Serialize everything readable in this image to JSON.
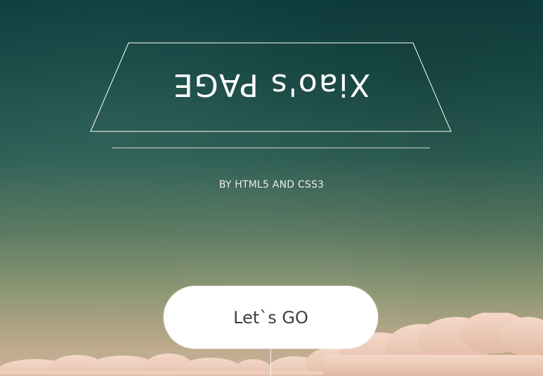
{
  "hero": {
    "title": "Xiao's PAGE",
    "subtitle": "BY HTML5 AND CSS3",
    "cta_label": "Let`s   GO"
  },
  "colors": {
    "sky_top": "#0f3e3e",
    "sky_bottom": "#cfb39a",
    "cloud": "#f4d8c8",
    "button_bg": "#ffffff",
    "button_text": "#3f3f3f",
    "line": "#ffffff"
  }
}
